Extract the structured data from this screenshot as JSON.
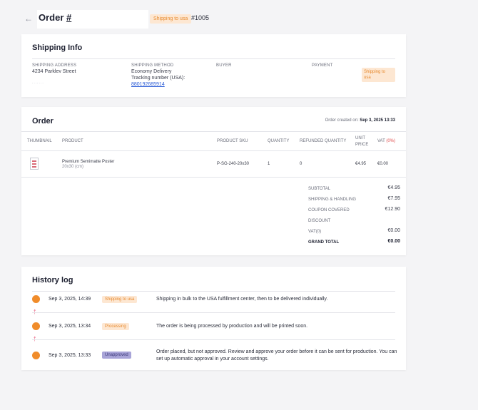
{
  "header": {
    "back_icon": "arrow-left-icon",
    "title": "Order #",
    "status_badge": "Shipping to usa",
    "order_number": "#1005"
  },
  "shipping_info": {
    "title": "Shipping Info",
    "columns": {
      "address": "SHIPPING ADDRESS",
      "method": "SHIPPING METHOD",
      "buyer": "BUYER",
      "payment": "PAYMENT"
    },
    "address_partial": "4234 Parkley Street",
    "address_dots": ".......",
    "method": "Economy Delivery",
    "tracking_label": "Tracking number (USA):",
    "tracking_number": "880192685914",
    "payment_badge": "Shipping to usa"
  },
  "order": {
    "title": "Order",
    "created_label": "Order created on:",
    "created_value": "Sep 3, 2025 13:33",
    "headers": {
      "thumbnail": "THUMBNAIL",
      "product": "PRODUCT",
      "sku": "PRODUCT SKU",
      "quantity": "QUANTITY",
      "refunded": "REFUNDED QUANTITY",
      "unit_price_1": "UNIT",
      "unit_price_2": "PRICE",
      "vat": "VAT",
      "vat_pct": "(0%)"
    },
    "items": [
      {
        "product": "Premium Semimatte Poster",
        "size": "20x30 (cm)",
        "sku": "P-SG-240-20x30",
        "quantity": "1",
        "refunded": "0",
        "unit_price": "€4.95",
        "vat": "€0.00"
      }
    ],
    "totals": {
      "subtotal_label": "SUBTOTAL",
      "subtotal": "€4.95",
      "shipping_label": "SHIPPING & HANDLING",
      "shipping": "€7.95",
      "coupon_label": "COUPON COVERED",
      "coupon": "€12.90",
      "discount_label": "DISCOUNT",
      "vat_label": "VAT(0)",
      "vat": "€0.00",
      "grand_label": "GRAND TOTAL",
      "grand": "€0.00"
    }
  },
  "history": {
    "title": "History log",
    "entries": [
      {
        "date": "Sep 3, 2025, 14:39",
        "status": "Shipping to usa",
        "message": "Shipping in bulk to the USA fulfillment center, then to be delivered individually."
      },
      {
        "date": "Sep 3, 2025, 13:34",
        "status": "Processing",
        "message": "The order is being processed by production and will be printed soon."
      },
      {
        "date": "Sep 3, 2025, 13:33",
        "status": "Unapproved",
        "message": "Order placed, but not approved. Review and approve your order before it can be sent for production. You can set up automatic approval in your account settings."
      }
    ],
    "arrow_glyph": "↑"
  },
  "colors": {
    "accent_orange": "#f08c2a",
    "badge_orange_bg": "#fde7d2",
    "badge_purple_bg": "#a8a4d8",
    "link_blue": "#2a5bd6",
    "arrow_pink": "#e8577a"
  }
}
